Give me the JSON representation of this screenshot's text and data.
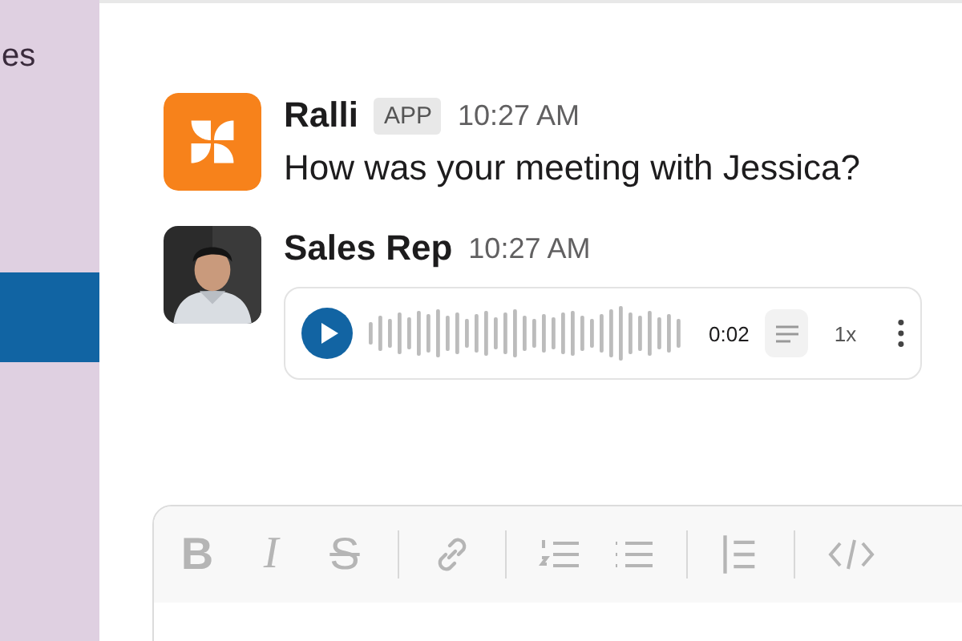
{
  "sidebar": {
    "items": [
      {
        "label": "es",
        "selected": false
      },
      {
        "selected": true
      }
    ]
  },
  "messages": [
    {
      "author": "Ralli",
      "badge": "APP",
      "time": "10:27 AM",
      "avatar": {
        "kind": "logo"
      },
      "text": "How was your meeting with Jessica?"
    },
    {
      "author": "Sales Rep",
      "time": "10:27 AM",
      "audio": {
        "duration": "0:02",
        "speed": "1x"
      }
    }
  ],
  "composer": {
    "toolbar": [
      {
        "kind": "bold",
        "label": "B"
      },
      {
        "kind": "italic",
        "label": "I"
      },
      {
        "kind": "strike",
        "label": "S"
      },
      {
        "kind": "divider"
      },
      {
        "kind": "link"
      },
      {
        "kind": "divider"
      },
      {
        "kind": "ordered"
      },
      {
        "kind": "bullets"
      },
      {
        "kind": "divider"
      },
      {
        "kind": "quote"
      },
      {
        "kind": "divider"
      },
      {
        "kind": "code"
      }
    ]
  }
}
